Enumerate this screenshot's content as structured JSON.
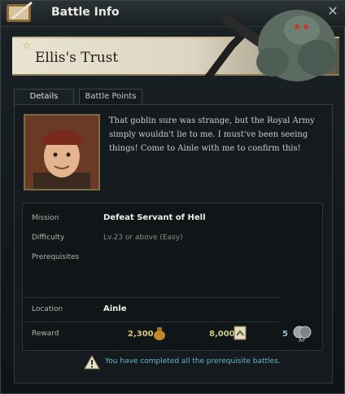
{
  "window": {
    "title": "Battle Info",
    "close_icon": "close-icon"
  },
  "quest": {
    "name": "Ellis's Trust",
    "star_icon": "star-icon"
  },
  "tabs": [
    {
      "label": "Details",
      "active": true
    },
    {
      "label": "Battle Points",
      "active": false
    }
  ],
  "dialogue": "That goblin sure was strange, but the Royal Army simply wouldn't lie to me. I must've been seeing things! Come to Ainle with me to confirm this!",
  "details": {
    "mission_label": "Mission",
    "mission_value": "Defeat Servant of Hell",
    "difficulty_label": "Difficulty",
    "difficulty_value": "Lv.23 or above (Easy)",
    "prerequisites_label": "Prerequisites",
    "location_label": "Location",
    "location_value": "Ainle",
    "reward_label": "Reward",
    "reward_gold": "2,300",
    "reward_exp": "8,000",
    "reward_ap": "5"
  },
  "notice": "You have completed all the prerequisite battles.",
  "colors": {
    "accent_gold": "#d8c27a",
    "notice_cyan": "#68b8c6",
    "exp_green": "#c8c98a"
  }
}
